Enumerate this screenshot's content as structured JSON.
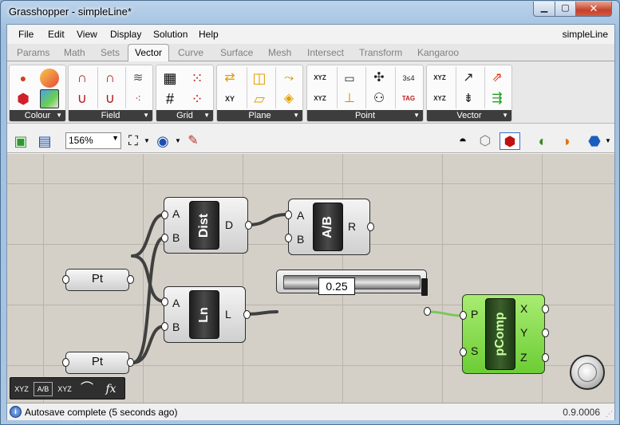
{
  "window": {
    "title": "Grasshopper - simpleLine*",
    "min_glyph": "▁",
    "max_glyph": "▢",
    "close_glyph": "✕"
  },
  "menu": {
    "items": [
      "File",
      "Edit",
      "View",
      "Display",
      "Solution",
      "Help"
    ],
    "document_name": "simpleLine"
  },
  "tabs": [
    "Params",
    "Math",
    "Sets",
    "Vector",
    "Curve",
    "Surface",
    "Mesh",
    "Intersect",
    "Transform",
    "Kangaroo"
  ],
  "active_tab": "Vector",
  "ribbon_groups": [
    "Colour",
    "Field",
    "Grid",
    "Plane",
    "Point",
    "Vector"
  ],
  "toolbar": {
    "zoom": "156%",
    "zoom_dropdown_glyph": "▼"
  },
  "components": {
    "dist": {
      "name": "Dist",
      "inputs": [
        "A",
        "B"
      ],
      "outputs": [
        "D"
      ]
    },
    "div": {
      "name": "A/B",
      "inputs": [
        "A",
        "B"
      ],
      "outputs": [
        "R"
      ]
    },
    "line": {
      "name": "Ln",
      "inputs": [
        "A",
        "B"
      ],
      "outputs": [
        "L"
      ]
    },
    "pt1": {
      "name": "Pt"
    },
    "pt2": {
      "name": "Pt"
    },
    "slider": {
      "value": "0.25"
    },
    "pcomp": {
      "name": "pComp",
      "inputs": [
        "P",
        "S"
      ],
      "outputs": [
        "X",
        "Y",
        "Z"
      ]
    }
  },
  "dock_icons": [
    "XYZ",
    "A/B",
    "XYZ",
    "⌒",
    "fx"
  ],
  "status": {
    "text": "Autosave complete (5 seconds ago)",
    "version": "0.9.0006",
    "icon_glyph": "i",
    "grip_glyph": "⋰"
  },
  "colors": {
    "canvas": "#d4d0c8",
    "component": "#dcdcdc",
    "component_selected": "#7ed444",
    "wire": "#404040",
    "wire_selected": "#7bc75a"
  }
}
